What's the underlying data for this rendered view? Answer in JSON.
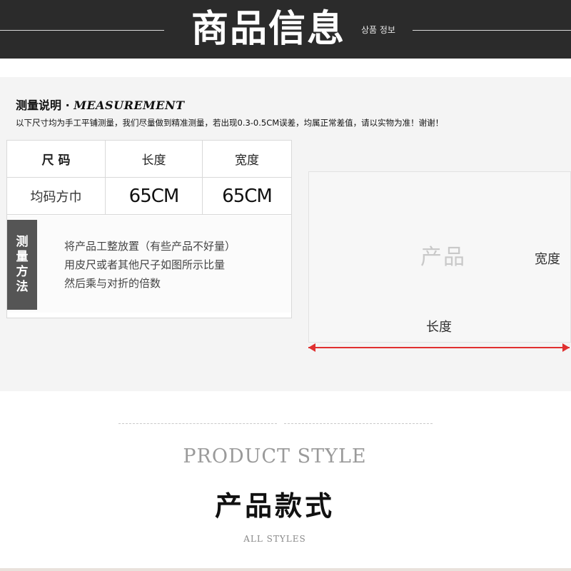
{
  "banner": {
    "title": "商品信息",
    "subtitle": "상품 정보"
  },
  "measurement": {
    "heading_cn": "测量说明 · ",
    "heading_en": "MEASUREMENT",
    "note": "以下尺寸均为手工平铺测量，我们尽量做到精准测量，若出现0.3-0.5CM误差，均属正常差值，请以实物为准！谢谢！"
  },
  "size_table": {
    "headers": [
      "尺 码",
      "长度",
      "宽度"
    ],
    "row": [
      "均码方巾",
      "65CM",
      "65CM"
    ]
  },
  "method": {
    "tag_chars": [
      "测",
      "量",
      "方",
      "法"
    ],
    "lines": [
      "将产品工整放置（有些产品不好量）",
      "用皮尺或者其他尺子如图所示比量",
      "然后乘与对折的倍数"
    ]
  },
  "diagram": {
    "product": "产品",
    "width": "宽度",
    "length": "长度",
    "arrow_color": "#e03030"
  },
  "product_style": {
    "en": "PRODUCT STYLE",
    "cn": "产品款式",
    "sub": "ALL STYLES"
  }
}
